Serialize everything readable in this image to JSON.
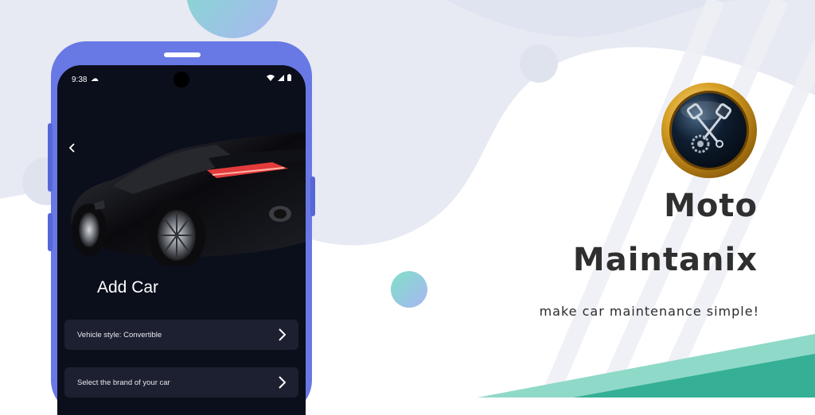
{
  "phone": {
    "status_time": "9:38",
    "screen_title": "Add Car",
    "rows": [
      {
        "label": "Vehicle style: Convertible"
      },
      {
        "label": "Select the brand of your car"
      }
    ],
    "icons": {
      "back": "chevron-left-icon",
      "camera": "camera-icon",
      "row_chevron": "chevron-right-icon",
      "status": [
        "cloud-icon",
        "wifi-icon",
        "signal-icon",
        "battery-icon"
      ]
    }
  },
  "promo": {
    "app_name_line1": "Moto",
    "app_name_line2": "Maintanix",
    "tagline": "make car maintenance simple!"
  },
  "colors": {
    "phone_frame": "#6878e4",
    "screen_bg": "#0b0e1b",
    "row_bg": "#1d2030",
    "accent_teal": "#7fdccd",
    "logo_gold": "#c8921a"
  }
}
